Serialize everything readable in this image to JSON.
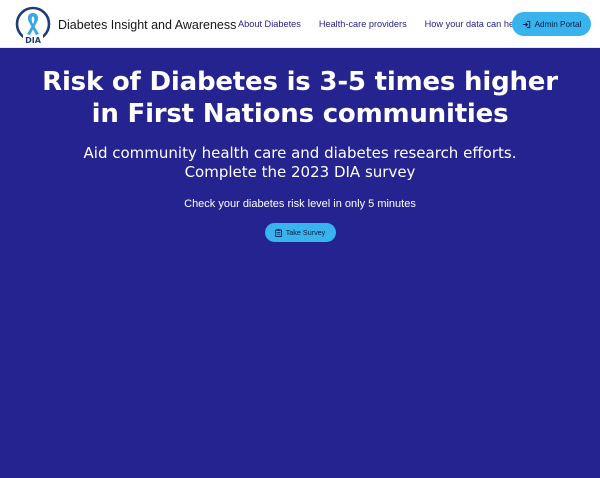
{
  "brand": {
    "logo_text": "DIA",
    "title": "Diabetes Insight and Awareness"
  },
  "nav": {
    "links": [
      {
        "label": "About Diabetes"
      },
      {
        "label": "Health-care providers"
      },
      {
        "label": "How your data can help"
      }
    ],
    "admin_button": {
      "label": "Admin Portal",
      "icon": "login-icon"
    }
  },
  "hero": {
    "title": "Risk of Diabetes is 3-5 times higher in First Nations communities",
    "subtitle_line1": "Aid community health care and diabetes research efforts.",
    "subtitle_line2": "Complete the 2023 DIA survey",
    "note": "Check your diabetes risk level in only 5 minutes",
    "survey_button": {
      "label": "Take Survey",
      "icon": "clipboard-icon"
    }
  },
  "colors": {
    "hero_background": "#24238f",
    "accent": "#37b3ee",
    "nav_link": "#24238f",
    "logo_ribbon": "#3aa6e3",
    "logo_ring": "#1f3c7a"
  }
}
